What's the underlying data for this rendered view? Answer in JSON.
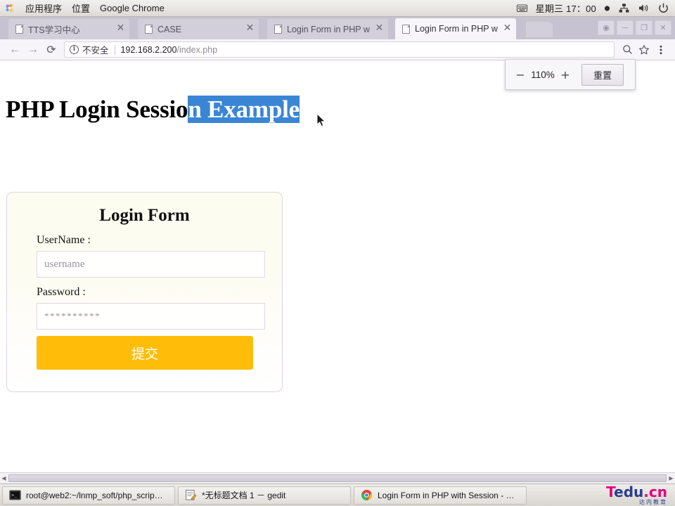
{
  "desktop": {
    "panel": {
      "menus": [
        "应用程序",
        "位置",
        "Google Chrome"
      ],
      "clock": "星期三 17：00",
      "tray_icons": [
        "keyboard-icon",
        "record-dot-icon",
        "network-icon",
        "volume-icon",
        "power-icon"
      ]
    },
    "taskbar": {
      "items": [
        {
          "icon": "terminal-icon",
          "label": "root@web2:~/lnmp_soft/php_scrip…"
        },
        {
          "icon": "gedit-icon",
          "label": "*无标题文档 1 － gedit"
        },
        {
          "icon": "chrome-icon",
          "label": "Login Form in PHP with Session - …"
        }
      ],
      "logo": {
        "t": "T",
        "edu": "edu",
        "cn": ".cn",
        "sub": "达内教育"
      }
    }
  },
  "browser": {
    "tabs": [
      {
        "title": "TTS学习中心",
        "active": false
      },
      {
        "title": "CASE",
        "active": false
      },
      {
        "title": "Login Form in PHP w",
        "active": false
      },
      {
        "title": "Login Form in PHP w",
        "active": true
      }
    ],
    "tab_close_label": "✕",
    "window_controls": [
      {
        "name": "profile-button",
        "glyph": "◉"
      },
      {
        "name": "minimize-button",
        "glyph": "─"
      },
      {
        "name": "maximize-button",
        "glyph": "❐"
      },
      {
        "name": "close-button",
        "glyph": "✕"
      }
    ],
    "toolbar": {
      "back_glyph": "←",
      "forward_glyph": "→",
      "reload_glyph": "⟳",
      "security_badge": "不安全",
      "security_glyph": "i",
      "url_host": "192.168.2.200",
      "url_path": "/index.php",
      "zoom_icon": "zoom-search-icon",
      "bookmark_icon": "star-icon",
      "menu_icon": "three-dot-menu-icon"
    },
    "zoom_bubble": {
      "minus": "−",
      "level": "110%",
      "plus": "+",
      "reset_label": "重置"
    }
  },
  "page": {
    "heading_plain": "PHP Login Sessio",
    "heading_selected": "n Example",
    "form": {
      "title": "Login Form",
      "username_label": "UserName :",
      "username_placeholder": "username",
      "password_label": "Password :",
      "password_placeholder": "**********",
      "submit_label": "提交",
      "accent_color": "#ffbd0a"
    }
  },
  "scrollbar": {
    "left_arrow": "◀",
    "right_arrow": "▶"
  }
}
